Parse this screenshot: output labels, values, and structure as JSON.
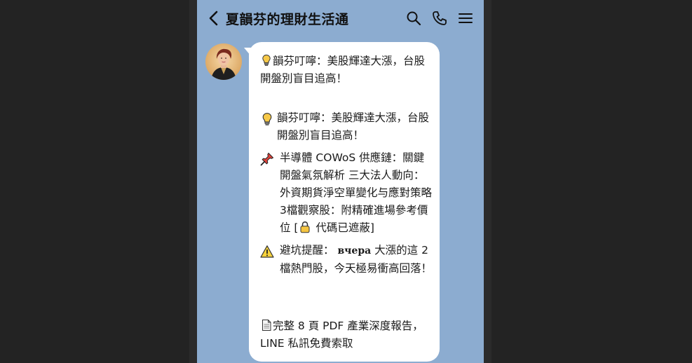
{
  "header": {
    "title": "夏韻芬的理財生活通"
  },
  "message": {
    "intro": "韻芬叮嚀：美股輝達大漲，台股開盤別盲目追高！",
    "bullets": [
      {
        "icon": "lightbulb-icon",
        "text": "韻芬叮嚀：美股輝達大漲，台股開盤別盲目追高！"
      },
      {
        "icon": "pushpin-icon",
        "text_before_lock": "半導體 COWoS 供應鏈：關鍵開盤氣氛解析 三大法人動向：外資期貨淨空單變化与應對策略 3檔觀察股：附精確進場參考價位 [",
        "text_after_lock": " 代碼已遮蔽]"
      },
      {
        "icon": "warning-icon",
        "text_before": "避坑提醒：",
        "serif_word": "вчера",
        "text_after": "大漲的這 2 檔熱門股，今天極易衝高回落！"
      }
    ],
    "footer": "完整 8 頁 PDF 產業深度報告，LINE 私訊免費索取"
  },
  "colors": {
    "chat_background": "#8cacd0",
    "bubble": "#ffffff",
    "frame": "#2b2b2b",
    "page": "#232323"
  }
}
